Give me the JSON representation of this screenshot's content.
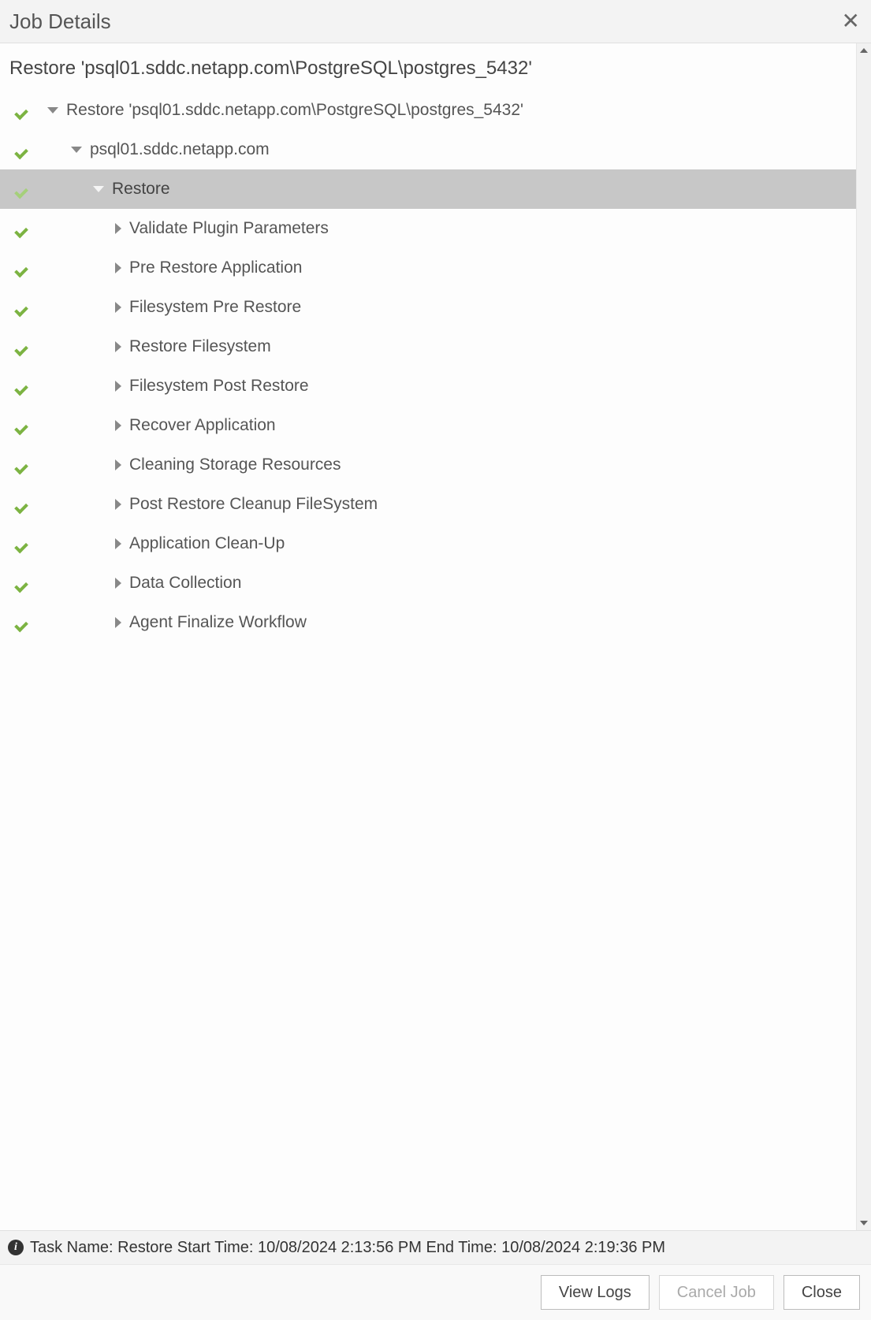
{
  "header": {
    "title": "Job Details"
  },
  "sub_title": "Restore 'psql01.sddc.netapp.com\\PostgreSQL\\postgres_5432'",
  "tree": [
    {
      "level": 1,
      "expanded": true,
      "selected": false,
      "status": "ok",
      "label": "Restore 'psql01.sddc.netapp.com\\PostgreSQL\\postgres_5432'"
    },
    {
      "level": 2,
      "expanded": true,
      "selected": false,
      "status": "ok",
      "label": "psql01.sddc.netapp.com"
    },
    {
      "level": 3,
      "expanded": true,
      "selected": true,
      "status": "ok-muted",
      "label": "Restore"
    },
    {
      "level": 4,
      "expanded": false,
      "selected": false,
      "status": "ok",
      "label": "Validate Plugin Parameters"
    },
    {
      "level": 4,
      "expanded": false,
      "selected": false,
      "status": "ok",
      "label": "Pre Restore Application"
    },
    {
      "level": 4,
      "expanded": false,
      "selected": false,
      "status": "ok",
      "label": "Filesystem Pre Restore"
    },
    {
      "level": 4,
      "expanded": false,
      "selected": false,
      "status": "ok",
      "label": "Restore Filesystem"
    },
    {
      "level": 4,
      "expanded": false,
      "selected": false,
      "status": "ok",
      "label": "Filesystem Post Restore"
    },
    {
      "level": 4,
      "expanded": false,
      "selected": false,
      "status": "ok",
      "label": "Recover Application"
    },
    {
      "level": 4,
      "expanded": false,
      "selected": false,
      "status": "ok",
      "label": "Cleaning Storage Resources"
    },
    {
      "level": 4,
      "expanded": false,
      "selected": false,
      "status": "ok",
      "label": "Post Restore Cleanup FileSystem"
    },
    {
      "level": 4,
      "expanded": false,
      "selected": false,
      "status": "ok",
      "label": "Application Clean-Up"
    },
    {
      "level": 4,
      "expanded": false,
      "selected": false,
      "status": "ok",
      "label": "Data Collection"
    },
    {
      "level": 4,
      "expanded": false,
      "selected": false,
      "status": "ok",
      "label": "Agent Finalize Workflow"
    }
  ],
  "status_bar": {
    "text": "Task Name: Restore Start Time: 10/08/2024 2:13:56 PM End Time: 10/08/2024 2:19:36 PM"
  },
  "footer": {
    "view_logs": "View Logs",
    "cancel_job": "Cancel Job",
    "close": "Close"
  }
}
